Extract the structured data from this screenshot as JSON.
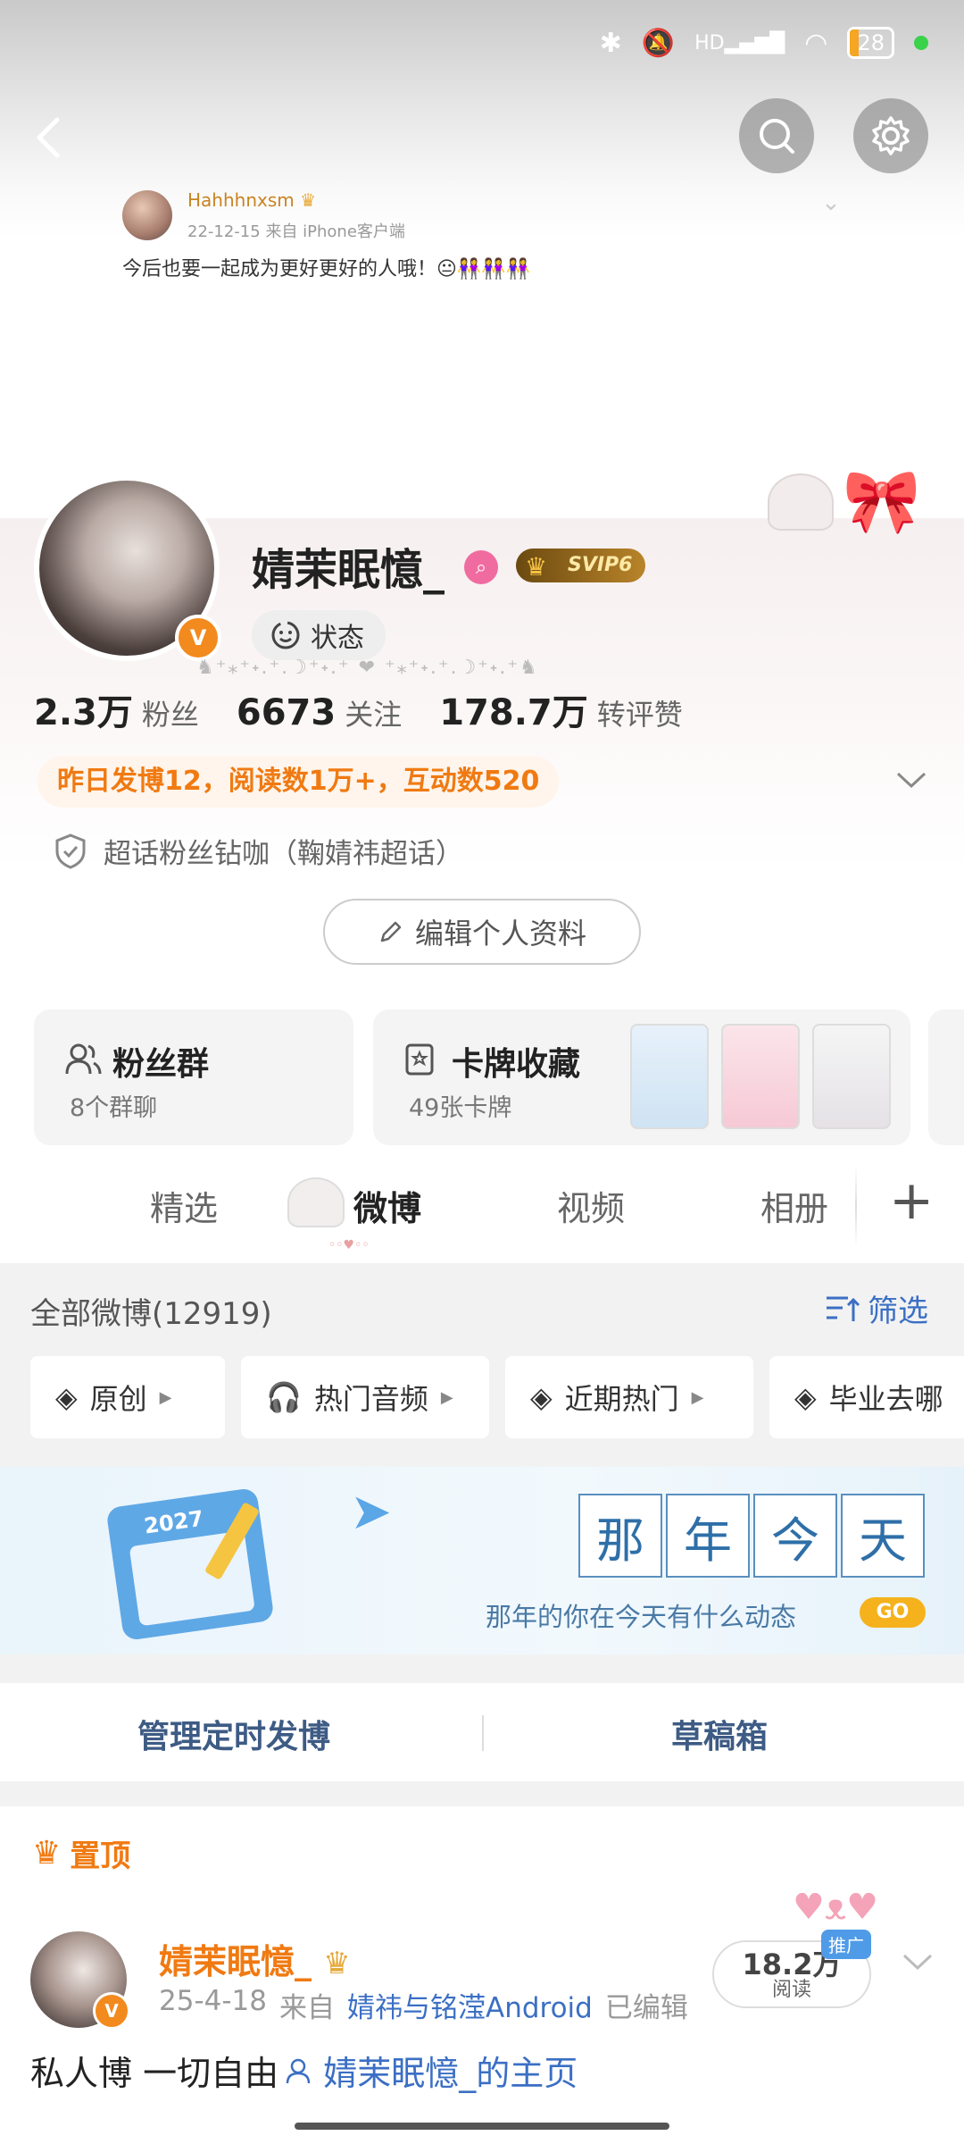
{
  "status_bar": {
    "hd": "HD",
    "battery": "28"
  },
  "embedded_post": {
    "author": "Hahhhnxsm",
    "time": "22-12-15",
    "source": "来自 iPhone客户端",
    "text": "今后也要一起成为更好更好的人哦！😐👭👭👭"
  },
  "profile": {
    "name": "婧茉眠憶_",
    "svip": "SVIP6",
    "verified_mark": "V",
    "state_label": "状态",
    "stats": [
      {
        "num": "2.3万",
        "label": "粉丝"
      },
      {
        "num": "6673",
        "label": "关注"
      },
      {
        "num": "178.7万",
        "label": "转评赞"
      }
    ],
    "activity": "昨日发博12，阅读数1万+，互动数520",
    "chaohua": "超话粉丝钻咖（鞠婧祎超话）",
    "edit_button": "编辑个人资料"
  },
  "cards": {
    "fans_title": "粉丝群",
    "fans_sub": "8个群聊",
    "card_title": "卡牌收藏",
    "card_sub": "49张卡牌"
  },
  "tabs": [
    "精选",
    "微博",
    "视频",
    "相册"
  ],
  "feed": {
    "all_label": "全部微博(12919)",
    "filter_label": "筛选",
    "chips": [
      "原创",
      "热门音频",
      "近期热门",
      "毕业去哪"
    ]
  },
  "banner": {
    "chars": [
      "那",
      "年",
      "今",
      "天"
    ],
    "subtitle": "那年的你在今天有什么动态",
    "go": "GO",
    "calendar_year": "2027"
  },
  "manage": {
    "scheduled": "管理定时发博",
    "drafts": "草稿箱"
  },
  "pinned_post": {
    "pin_label": "置顶",
    "author": "婧茉眠憶_",
    "date": "25-4-18",
    "from": "来自",
    "source": "婧祎与铭滢Android",
    "edited": "已编辑",
    "reads": "18.2万",
    "reads_label": "阅读",
    "promo": "推广",
    "text": "私人博 一切自由",
    "link_text": "婧茉眠憶_的主页"
  },
  "colors": {
    "accent_orange": "#f07a12",
    "link_blue": "#3b6fc4",
    "svip_gold": "#b9842a"
  }
}
